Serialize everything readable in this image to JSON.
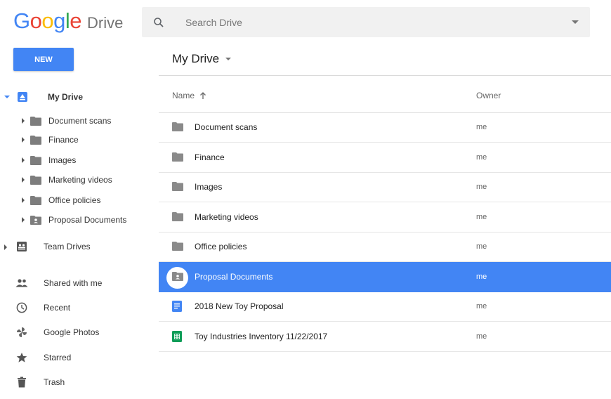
{
  "header": {
    "logo_letters": [
      {
        "char": "G",
        "color": "#4285F4"
      },
      {
        "char": "o",
        "color": "#EA4335"
      },
      {
        "char": "o",
        "color": "#FBBC05"
      },
      {
        "char": "g",
        "color": "#4285F4"
      },
      {
        "char": "l",
        "color": "#34A853"
      },
      {
        "char": "e",
        "color": "#EA4335"
      }
    ],
    "product": "Drive",
    "search_placeholder": "Search Drive"
  },
  "toolbar": {
    "new_label": "NEW",
    "breadcrumb": "My Drive"
  },
  "sidebar": {
    "my_drive": "My Drive",
    "folders": [
      {
        "label": "Document scans",
        "icon": "folder-icon"
      },
      {
        "label": "Finance",
        "icon": "folder-icon"
      },
      {
        "label": "Images",
        "icon": "folder-icon"
      },
      {
        "label": "Marketing videos",
        "icon": "folder-icon"
      },
      {
        "label": "Office policies",
        "icon": "folder-icon"
      },
      {
        "label": "Proposal Documents",
        "icon": "shared-folder-icon"
      }
    ],
    "nav": [
      {
        "label": "Team Drives",
        "icon": "team-drives-icon"
      },
      {
        "label": "Shared with me",
        "icon": "people-icon"
      },
      {
        "label": "Recent",
        "icon": "clock-icon"
      },
      {
        "label": "Google Photos",
        "icon": "pinwheel-icon"
      },
      {
        "label": "Starred",
        "icon": "star-icon"
      },
      {
        "label": "Trash",
        "icon": "trash-icon"
      }
    ]
  },
  "list": {
    "columns": {
      "name": "Name",
      "owner": "Owner"
    },
    "rows": [
      {
        "name": "Document scans",
        "owner": "me",
        "icon": "folder-icon"
      },
      {
        "name": "Finance",
        "owner": "me",
        "icon": "folder-icon"
      },
      {
        "name": "Images",
        "owner": "me",
        "icon": "folder-icon"
      },
      {
        "name": "Marketing videos",
        "owner": "me",
        "icon": "folder-icon"
      },
      {
        "name": "Office policies",
        "owner": "me",
        "icon": "folder-icon"
      },
      {
        "name": "Proposal Documents",
        "owner": "me",
        "icon": "shared-folder-icon",
        "selected": true
      },
      {
        "name": "2018 New Toy Proposal",
        "owner": "me",
        "icon": "docs-icon"
      },
      {
        "name": "Toy Industries Inventory 11/22/2017",
        "owner": "me",
        "icon": "sheets-icon"
      }
    ]
  },
  "colors": {
    "accent": "#4285F4",
    "sheets": "#0F9D58",
    "folder": "#8A8A8A"
  }
}
